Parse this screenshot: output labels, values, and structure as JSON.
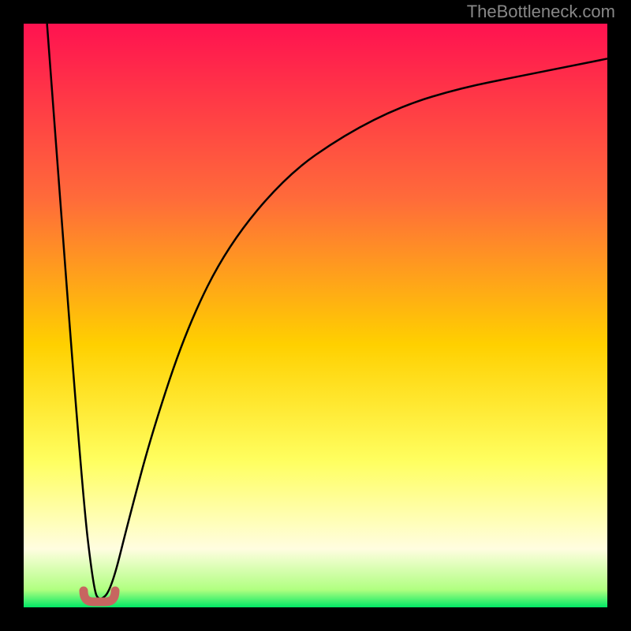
{
  "watermark": "TheBottleneck.com",
  "chart_data": {
    "type": "line",
    "title": "",
    "xlabel": "",
    "ylabel": "",
    "xlim": [
      0,
      100
    ],
    "ylim": [
      0,
      100
    ],
    "description": "V-shaped curve with sharp descent and asymptotic rise; minimum near x=13",
    "curve_points": [
      {
        "x": 4,
        "y": 100
      },
      {
        "x": 10,
        "y": 20
      },
      {
        "x": 12,
        "y": 3
      },
      {
        "x": 13,
        "y": 1
      },
      {
        "x": 15,
        "y": 3
      },
      {
        "x": 18,
        "y": 15
      },
      {
        "x": 22,
        "y": 30
      },
      {
        "x": 28,
        "y": 48
      },
      {
        "x": 35,
        "y": 62
      },
      {
        "x": 45,
        "y": 74
      },
      {
        "x": 55,
        "y": 81
      },
      {
        "x": 65,
        "y": 86
      },
      {
        "x": 75,
        "y": 89
      },
      {
        "x": 85,
        "y": 91
      },
      {
        "x": 95,
        "y": 93
      },
      {
        "x": 100,
        "y": 94
      }
    ],
    "minimum_marker": {
      "x": 13,
      "y": 1,
      "color": "#c76560"
    },
    "gradient_stops": [
      {
        "position": 0,
        "color": "#ff1250"
      },
      {
        "position": 30,
        "color": "#ff6b3a"
      },
      {
        "position": 55,
        "color": "#ffd000"
      },
      {
        "position": 75,
        "color": "#ffff60"
      },
      {
        "position": 90,
        "color": "#fffde0"
      },
      {
        "position": 97,
        "color": "#b0ff80"
      },
      {
        "position": 100,
        "color": "#00e865"
      }
    ]
  }
}
